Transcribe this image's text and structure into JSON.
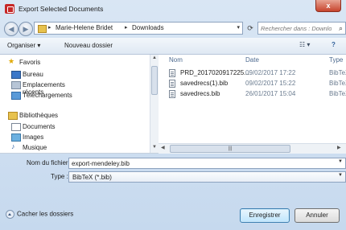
{
  "window": {
    "title": "Export Selected Documents",
    "close_symbol": "x"
  },
  "nav": {
    "back_symbol": "◀",
    "forward_symbol": "▶",
    "path_sep1": "▸",
    "path_user": "Marie-Helene Bridet",
    "path_sep2": "▸",
    "path_folder": "Downloads",
    "path_dropdown": "▾",
    "refresh_symbol": "⟳",
    "search_placeholder": "Rechercher dans : Downloads"
  },
  "toolbar": {
    "organize": "Organiser ▾",
    "new_folder": "Nouveau dossier",
    "view_symbol": "☷ ▾",
    "help_symbol": "?"
  },
  "sidebar": {
    "favorites": "Favoris",
    "items": [
      {
        "label": "Bureau"
      },
      {
        "label": "Emplacements récents"
      },
      {
        "label": "Téléchargements"
      }
    ],
    "libraries": "Bibliothèques",
    "lib_items": [
      {
        "label": "Documents"
      },
      {
        "label": "Images"
      },
      {
        "label": "Musique"
      }
    ]
  },
  "files": {
    "columns": {
      "name": "Nom",
      "date": "Date",
      "type": "Type"
    },
    "rows": [
      {
        "name": "PRD_2017020917225...",
        "date": "09/02/2017 17:22",
        "type": "BibTeX"
      },
      {
        "name": "savedrecs(1).bib",
        "date": "09/02/2017 15:22",
        "type": "BibTeX"
      },
      {
        "name": "savedrecs.bib",
        "date": "26/01/2017 15:04",
        "type": "BibTeX"
      }
    ]
  },
  "form": {
    "filename_label": "Nom du fichier :",
    "filename_value": "export-mendeley.bib",
    "type_label": "Type :",
    "type_value": "BibTeX (*.bib)"
  },
  "footer": {
    "hide_folders": "Cacher les dossiers",
    "save_button": "Enregistrer",
    "cancel_button": "Annuler"
  },
  "colors": {
    "window_bg": "#c6d9ee",
    "accent_app_icon": "#c62828",
    "close_button": "#c7442d",
    "primary_button": "#bee6fd"
  }
}
